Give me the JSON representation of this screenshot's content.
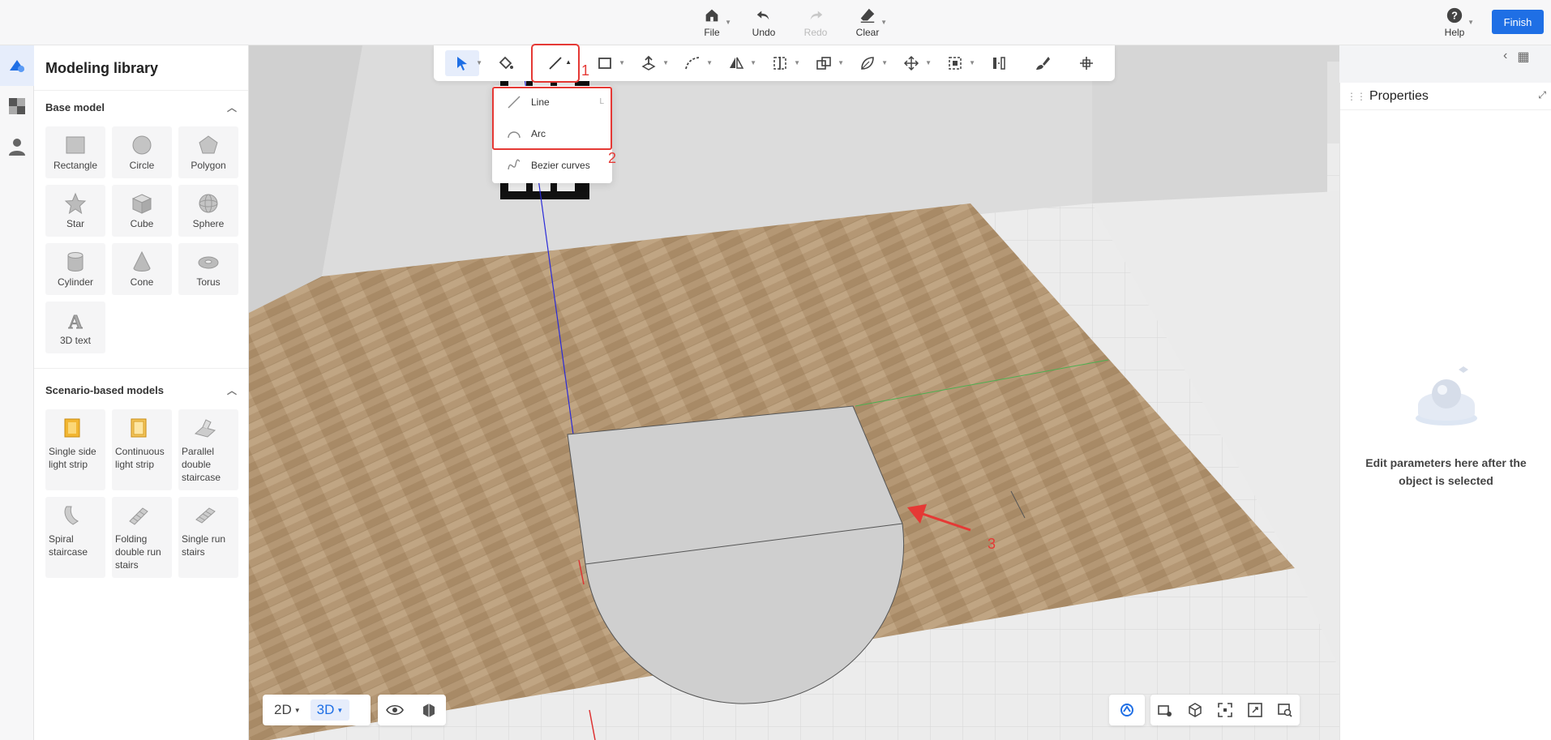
{
  "topbar": {
    "file": "File",
    "undo": "Undo",
    "redo": "Redo",
    "clear": "Clear",
    "help": "Help",
    "finish": "Finish"
  },
  "library": {
    "title": "Modeling library",
    "base_model_title": "Base model",
    "base_models": [
      "Rectangle",
      "Circle",
      "Polygon",
      "Star",
      "Cube",
      "Sphere",
      "Cylinder",
      "Cone",
      "Torus",
      "3D text"
    ],
    "scenario_title": "Scenario-based models",
    "scenario_models": [
      "Single side light strip",
      "Continuous light strip",
      "Parallel double staircase",
      "Spiral staircase",
      "Folding double run stairs",
      "Single run stairs"
    ]
  },
  "dropdown": {
    "items": [
      {
        "label": "Line",
        "key": "L"
      },
      {
        "label": "Arc",
        "key": ""
      },
      {
        "label": "Bezier curves",
        "key": ""
      }
    ]
  },
  "annotations": {
    "n1": "1",
    "n2": "2",
    "n3": "3"
  },
  "view": {
    "mode_2d": "2D",
    "mode_3d": "3D"
  },
  "properties": {
    "title": "Properties",
    "empty_message": "Edit parameters here after the object is selected"
  },
  "colors": {
    "accent": "#1f6fe5",
    "annotation": "#e53935"
  }
}
